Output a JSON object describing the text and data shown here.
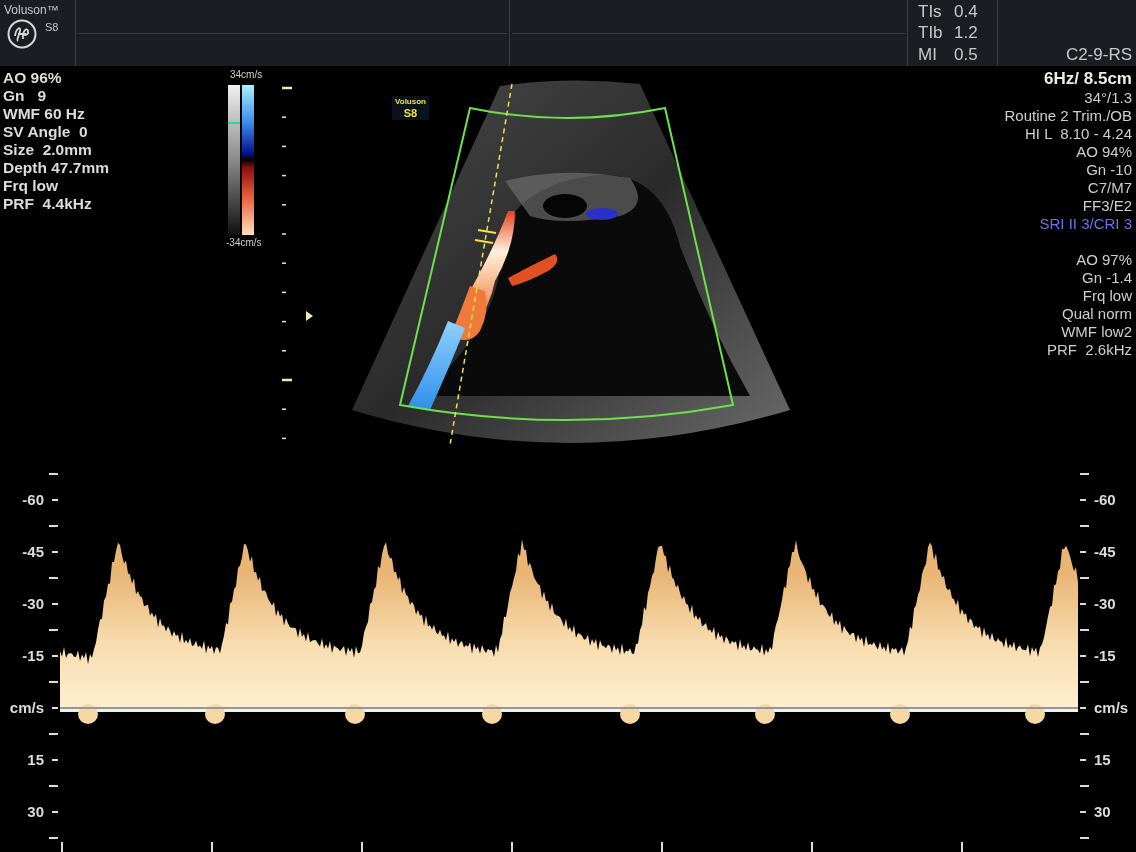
{
  "header": {
    "brand": "Voluson™",
    "model": "S8",
    "indices": [
      {
        "label": "TIs",
        "value": "0.4"
      },
      {
        "label": "TIb",
        "value": "1.2"
      },
      {
        "label": "MI",
        "value": "0.5"
      }
    ],
    "probe": "C2-9-RS"
  },
  "left_params": [
    "AO 96%",
    "Gn   9",
    "WMF 60 Hz",
    "SV Angle  0",
    "Size  2.0mm",
    "Depth 47.7mm",
    "Frq low",
    "PRF  4.4kHz"
  ],
  "color_scale": {
    "top": "34cm/s",
    "bottom": "-34cm/s"
  },
  "image_label": {
    "brand": "Voluson",
    "model": "S8"
  },
  "right_params": {
    "bmode": [
      {
        "text": "6Hz/ 8.5cm",
        "kind": "title"
      },
      {
        "text": "34°/1.3",
        "kind": "normal"
      },
      {
        "text": "Routine 2 Trim./OB",
        "kind": "normal"
      },
      {
        "text": "HI L  8.10 - 4.24",
        "kind": "normal"
      },
      {
        "text": "AO 94%",
        "kind": "normal"
      },
      {
        "text": "Gn -10",
        "kind": "normal"
      },
      {
        "text": "C7/M7",
        "kind": "normal"
      },
      {
        "text": "FF3/E2",
        "kind": "normal"
      },
      {
        "text": "SRI II 3/CRI 3",
        "kind": "highlight"
      }
    ],
    "doppler": [
      {
        "text": "AO 97%",
        "kind": "normal"
      },
      {
        "text": "Gn -1.4",
        "kind": "normal"
      },
      {
        "text": "Frq low",
        "kind": "normal"
      },
      {
        "text": "Qual norm",
        "kind": "normal"
      },
      {
        "text": "WMF low2",
        "kind": "normal"
      },
      {
        "text": "PRF  2.6kHz",
        "kind": "normal"
      }
    ]
  },
  "spectrum": {
    "left_axis": [
      "-60",
      "-45",
      "-30",
      "-15",
      "cm/s",
      "15",
      "30"
    ],
    "right_axis": [
      "-60",
      "-45",
      "-30",
      "-15",
      "cm/s",
      "15",
      "30"
    ]
  }
}
